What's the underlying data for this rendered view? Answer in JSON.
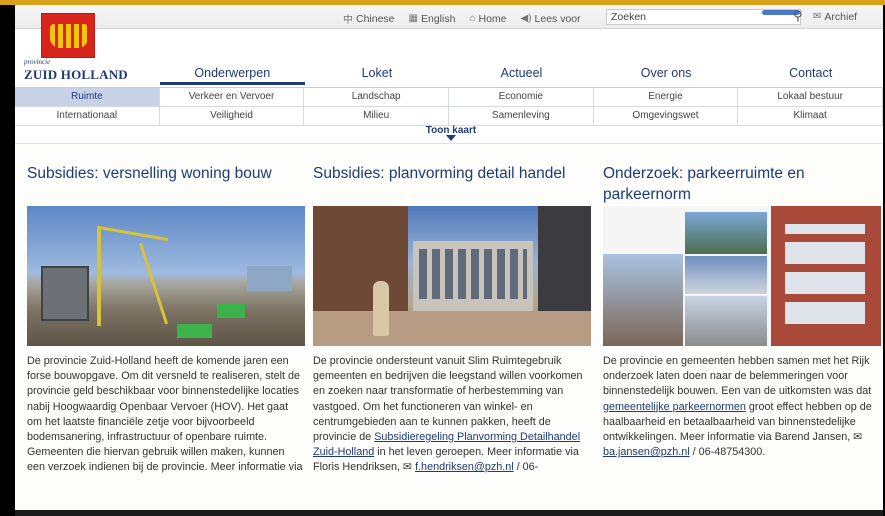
{
  "utility": {
    "chinese": "Chinese",
    "english": "English",
    "home": "Home",
    "lees_voor": "Lees voor",
    "search_placeholder": "Zoeken",
    "archief": "Archief"
  },
  "logo": {
    "small": "provincie",
    "big": "ZUID HOLLAND"
  },
  "mainnav": [
    "Onderwerpen",
    "Loket",
    "Actueel",
    "Over ons",
    "Contact"
  ],
  "subnav": [
    "Ruimte",
    "Verkeer en Vervoer",
    "Landschap",
    "Economie",
    "Energie",
    "Lokaal bestuur",
    "Internationaal",
    "Veiligheid",
    "Milieu",
    "Samenleving",
    "Omgevingswet",
    "Klimaat"
  ],
  "toon_kaart": "Toon kaart",
  "articles": [
    {
      "title": "Subsidies: versnelling woning bouw",
      "body": "De provincie Zuid-Holland heeft de komende jaren een forse bouwopgave. Om dit versneld te realiseren, stelt de provincie geld beschikbaar voor binnenstedelijke locaties nabij Hoogwaardig Openbaar Vervoer (HOV). Het gaat om het laatste financiële zetje voor bijvoorbeeld bodemsanering, infrastructuur of openbare ruimte. Gemeenten die hiervan gebruik willen maken, kunnen een verzoek indienen bij de provincie. Meer informatie via"
    },
    {
      "title": "Subsidies: planvorming detail handel",
      "body_a": "De provincie ondersteunt vanuit Slim Ruimtegebruik gemeenten en bedrijven die leegstand willen voorkomen en zoeken naar transformatie of herbestemming van vastgoed. Om het functioneren van winkel- en centrumgebieden aan te kunnen pakken, heeft de provincie de ",
      "link": "Subsidieregeling Planvorming Detailhandel Zuid-Holland",
      "body_b": " in het leven geroepen. Meer informatie via Floris Hendriksen, ",
      "email": "f.hendriksen@pzh.nl",
      "body_c": " / 06-"
    },
    {
      "title": "Onderzoek: parkeerruimte en parkeernorm",
      "body_a": "De provincie en gemeenten hebben samen met het Rijk onderzoek laten doen naar de belemmeringen voor binnenstedelijk bouwen. Een van de uitkomsten was dat ",
      "link": "gemeentelijke parkeernormen",
      "body_b": " groot effect hebben op de haalbaarheid en betaalbaarheid van binnenstedelijke ontwikkelingen. Meer informatie via Barend Jansen, ",
      "email": "ba.jansen@pzh.nl",
      "body_c": " / 06-48754300."
    }
  ]
}
